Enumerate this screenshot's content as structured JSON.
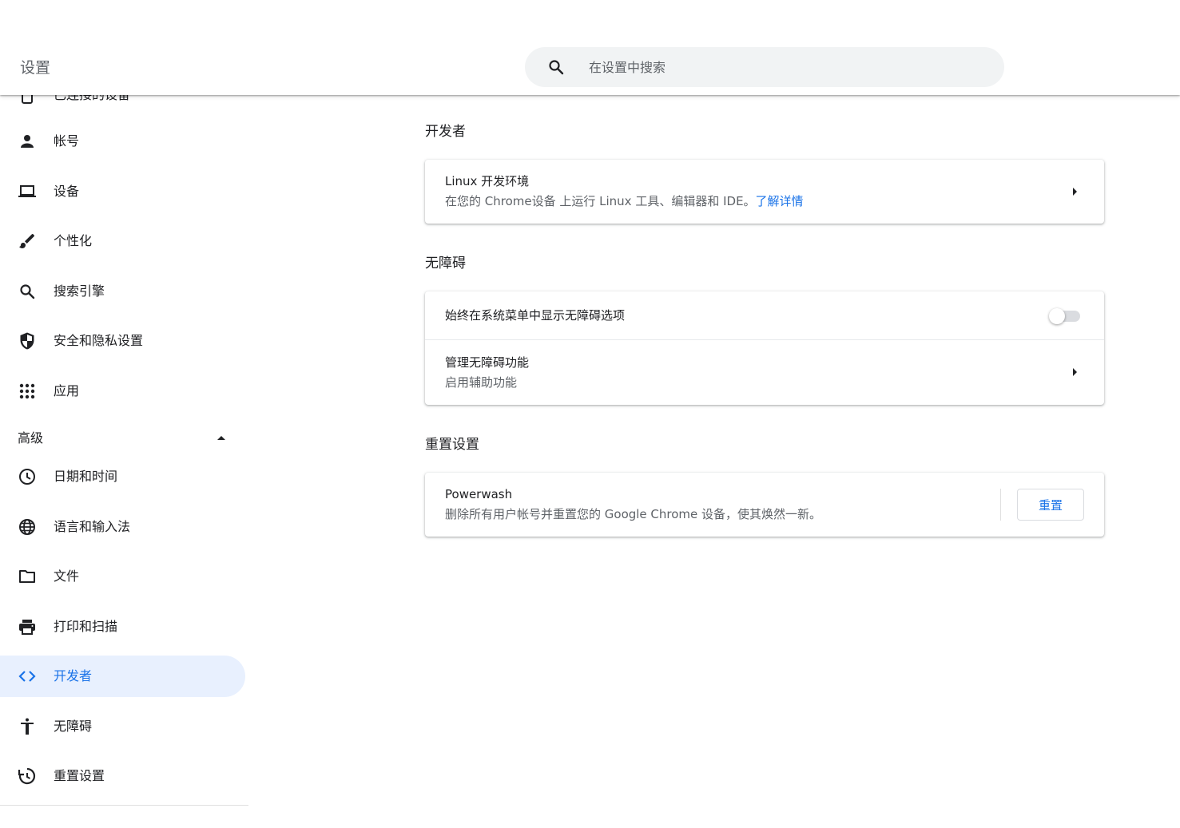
{
  "header": {
    "title": "设置",
    "search_placeholder": "在设置中搜索"
  },
  "sidebar": {
    "partial_item_label": "已连接的设备",
    "items": [
      {
        "label": "帐号",
        "icon": "person-icon"
      },
      {
        "label": "设备",
        "icon": "laptop-icon"
      },
      {
        "label": "个性化",
        "icon": "brush-icon"
      },
      {
        "label": "搜索引擎",
        "icon": "search-icon"
      },
      {
        "label": "安全和隐私设置",
        "icon": "shield-icon"
      },
      {
        "label": "应用",
        "icon": "apps-grid-icon"
      }
    ],
    "advanced_label": "高级",
    "advanced_items": [
      {
        "label": "日期和时间",
        "icon": "clock-icon"
      },
      {
        "label": "语言和输入法",
        "icon": "globe-icon"
      },
      {
        "label": "文件",
        "icon": "folder-icon"
      },
      {
        "label": "打印和扫描",
        "icon": "printer-icon"
      },
      {
        "label": "开发者",
        "icon": "code-icon",
        "active": true
      },
      {
        "label": "无障碍",
        "icon": "accessibility-icon"
      },
      {
        "label": "重置设置",
        "icon": "restore-icon"
      }
    ]
  },
  "main": {
    "developer": {
      "title": "开发者",
      "linux_title": "Linux 开发环境",
      "linux_sub": "在您的 Chrome设备 上运行 Linux 工具、编辑器和 IDE。",
      "learn_more": "了解详情"
    },
    "accessibility": {
      "title": "无障碍",
      "always_show_label": "始终在系统菜单中显示无障碍选项",
      "always_show_enabled": false,
      "manage_title": "管理无障碍功能",
      "manage_sub": "启用辅助功能"
    },
    "reset": {
      "title": "重置设置",
      "powerwash_title": "Powerwash",
      "powerwash_sub": "删除所有用户帐号并重置您的 Google Chrome 设备，使其焕然一新。",
      "reset_button": "重置"
    }
  },
  "colors": {
    "accent": "#1a73e8",
    "active_bg": "#e8f0fe",
    "icon": "#202124"
  }
}
